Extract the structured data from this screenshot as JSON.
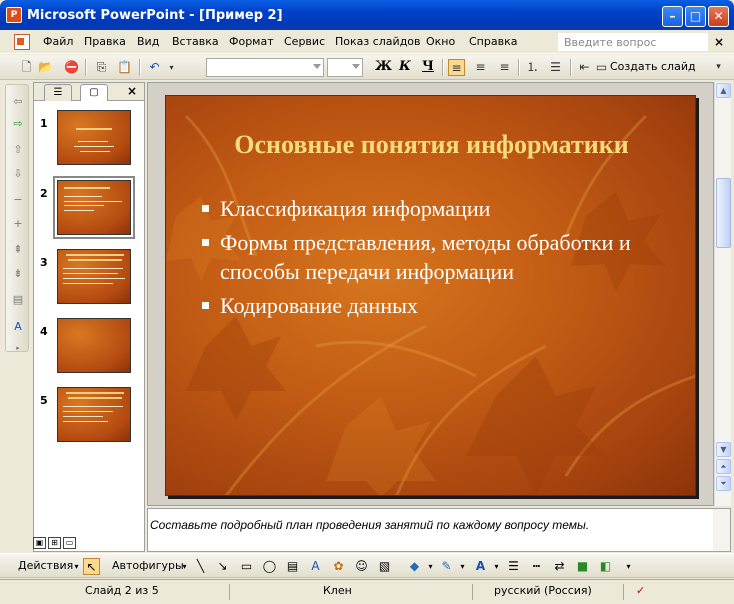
{
  "window": {
    "title": "Microsoft PowerPoint - [Пример 2]",
    "app_icon": "P",
    "minimize_label": "–",
    "maximize_label": "□",
    "close_label": "✕"
  },
  "menu": {
    "items": [
      "Файл",
      "Правка",
      "Вид",
      "Вставка",
      "Формат",
      "Сервис",
      "Показ слайдов",
      "Окно",
      "Справка"
    ],
    "search_placeholder": "Введите вопрос",
    "close_label": "×"
  },
  "toolbar": {
    "bold_label": "Ж",
    "italic_label": "К",
    "underline_label": "Ч",
    "new_slide_label": "Создать слайд",
    "font_name": "",
    "font_size": ""
  },
  "thumbnails": {
    "tab_outline": "☰",
    "tab_slides": "▢",
    "close_label": "×",
    "numbers": [
      "1",
      "2",
      "3",
      "4",
      "5"
    ],
    "selected_index": 2
  },
  "slide": {
    "title": "Основные понятия информатики",
    "bullets": [
      "Классификация информации",
      "Формы представления, методы обработки и способы передачи информации",
      "Кодирование данных"
    ]
  },
  "notes": {
    "text": "Составьте подробный план проведения занятий по каждому вопросу темы."
  },
  "drawbar": {
    "actions_label": "Действия",
    "autoshapes_label": "Автофигуры"
  },
  "status": {
    "slide_info": "Слайд 2 из 5",
    "design": "Клен",
    "language": "русский (Россия)"
  },
  "colors": {
    "slide_background": "#c35c14",
    "slide_title": "#f6dc7a",
    "titlebar": "#0040c8"
  }
}
